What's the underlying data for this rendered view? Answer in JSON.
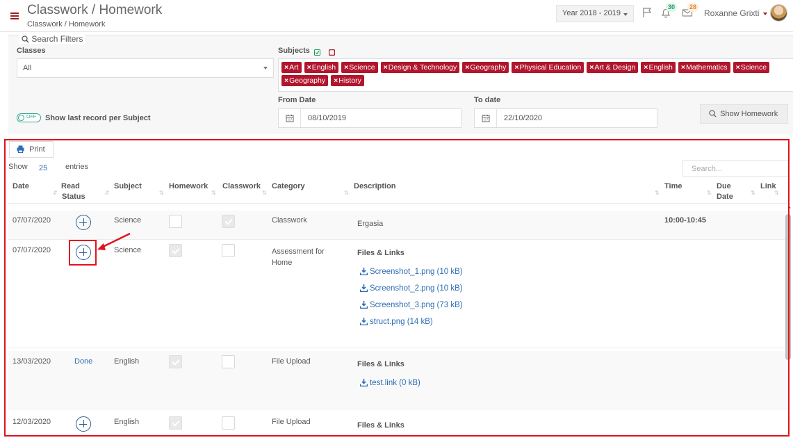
{
  "header": {
    "title": "Classwork / Homework",
    "breadcrumb": "Classwork / Homework",
    "year": "Year 2018 - 2019",
    "notifications_count": "30",
    "messages_count": "28",
    "user_name": "Roxanne Grixti"
  },
  "filters": {
    "legend": "Search Filters",
    "classes_label": "Classes",
    "classes_value": "All",
    "subjects_label": "Subjects",
    "subjects": [
      "Art",
      "English",
      "Science",
      "Design & Technology",
      "Geography",
      "Physical Education",
      "Art & Design",
      "English",
      "Mathematics",
      "Science",
      "Geography",
      "History"
    ],
    "toggle_state": "OFF",
    "toggle_label": "Show last record per Subject",
    "from_date_label": "From Date",
    "from_date": "08/10/2019",
    "to_date_label": "To date",
    "to_date": "22/10/2020",
    "show_button": "Show Homework"
  },
  "table": {
    "print_label": "Print",
    "show_label": "Show",
    "entries_value": "25",
    "entries_label": "entries",
    "search_placeholder": "Search...",
    "columns": {
      "date": "Date",
      "read_status_1": "Read",
      "read_status_2": "Status",
      "subject": "Subject",
      "homework": "Homework",
      "classwork": "Classwork",
      "category": "Category",
      "description": "Description",
      "time": "Time",
      "due_date_1": "Due",
      "due_date_2": "Date",
      "link": "Link"
    },
    "rows": [
      {
        "date": "07/07/2020",
        "subject": "Science",
        "homework": false,
        "classwork": true,
        "category": "Classwork",
        "description": "Ergasia",
        "time": "10:00-10:45"
      },
      {
        "date": "07/07/2020",
        "subject": "Science",
        "homework": true,
        "classwork": false,
        "category_1": "Assessment for",
        "category_2": "Home",
        "files_title": "Files & Links",
        "files": [
          "Screenshot_1.png (10 kB)",
          "Screenshot_2.png (10 kB)",
          "Screenshot_3.png (73 kB)",
          "struct.png (14 kB)"
        ]
      },
      {
        "date": "13/03/2020",
        "read_status": "Done",
        "subject": "English",
        "homework": true,
        "classwork": false,
        "category": "File Upload",
        "files_title": "Files & Links",
        "files": [
          "test.link (0 kB)"
        ]
      },
      {
        "date": "12/03/2020",
        "subject": "English",
        "homework": true,
        "classwork": false,
        "category": "File Upload",
        "files_title": "Files & Links"
      }
    ]
  },
  "colors": {
    "accent": "#b2162c",
    "link": "#2e6db4",
    "highlight": "#e1121d"
  }
}
